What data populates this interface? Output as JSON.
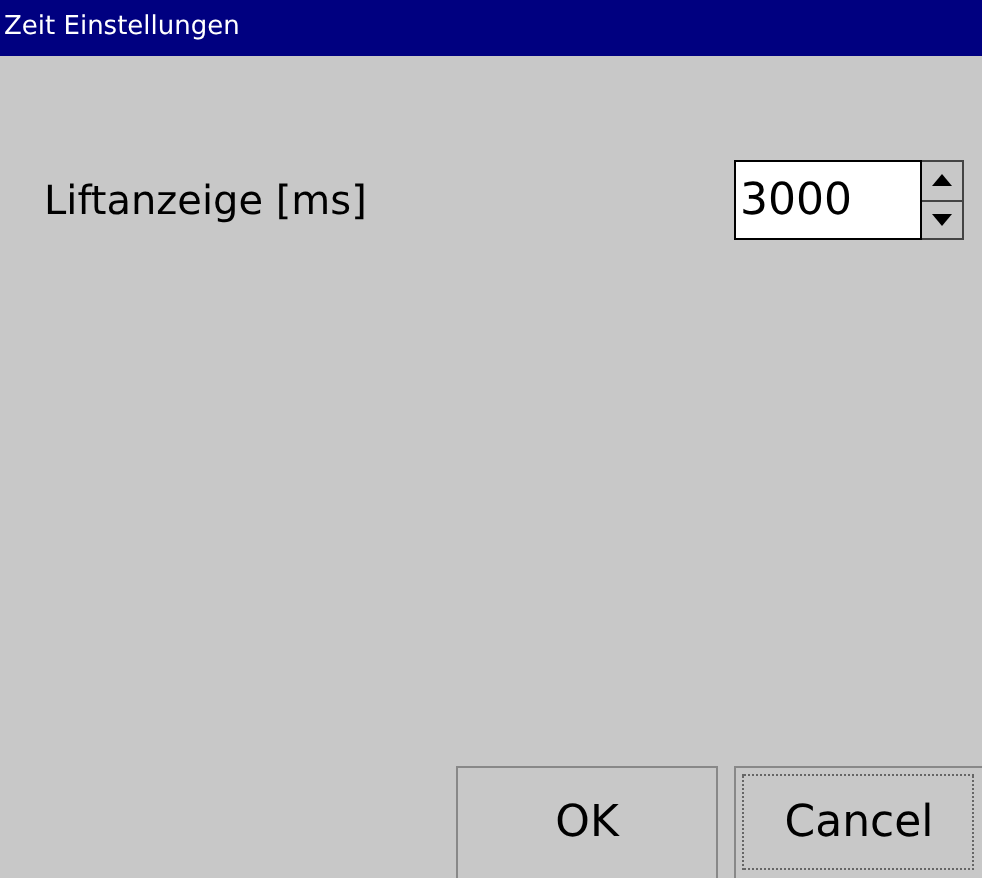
{
  "window": {
    "title": "Zeit Einstellungen"
  },
  "setting": {
    "label": "Liftanzeige [ms]",
    "value": "3000"
  },
  "buttons": [
    {
      "label": "OK",
      "focused": false
    },
    {
      "label": "Cancel",
      "focused": true
    }
  ]
}
